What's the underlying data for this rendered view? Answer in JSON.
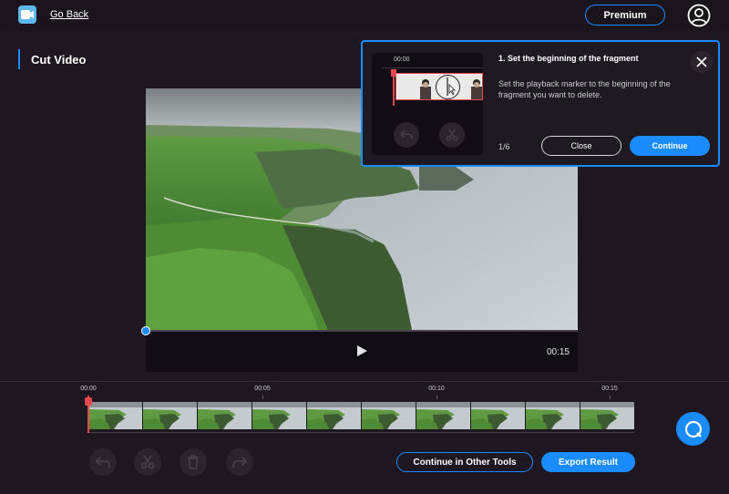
{
  "header": {
    "go_back_label": "Go Back",
    "premium_label": "Premium"
  },
  "page": {
    "title": "Cut Video"
  },
  "video": {
    "duration": "00:15",
    "playback_position_fraction": 0
  },
  "timeline": {
    "ticks": [
      "00:00",
      "00:05",
      "00:10",
      "00:15"
    ],
    "frame_count": 10
  },
  "tools": {
    "undo_icon": "undo-icon",
    "cut_icon": "scissors-icon",
    "delete_icon": "trash-icon",
    "redo_icon": "redo-icon"
  },
  "actions": {
    "other_tools_label": "Continue in Other Tools",
    "export_label": "Export Result"
  },
  "tutorial": {
    "preview_time": "00:00",
    "heading": "1. Set the beginning of the fragment",
    "description": "Set the playback marker to the beginning of the fragment you want to delete.",
    "step": "1/6",
    "close_label": "Close",
    "continue_label": "Continue"
  },
  "colors": {
    "accent": "#1a8cff",
    "background": "#1e1620",
    "playhead": "#e84a4f"
  }
}
